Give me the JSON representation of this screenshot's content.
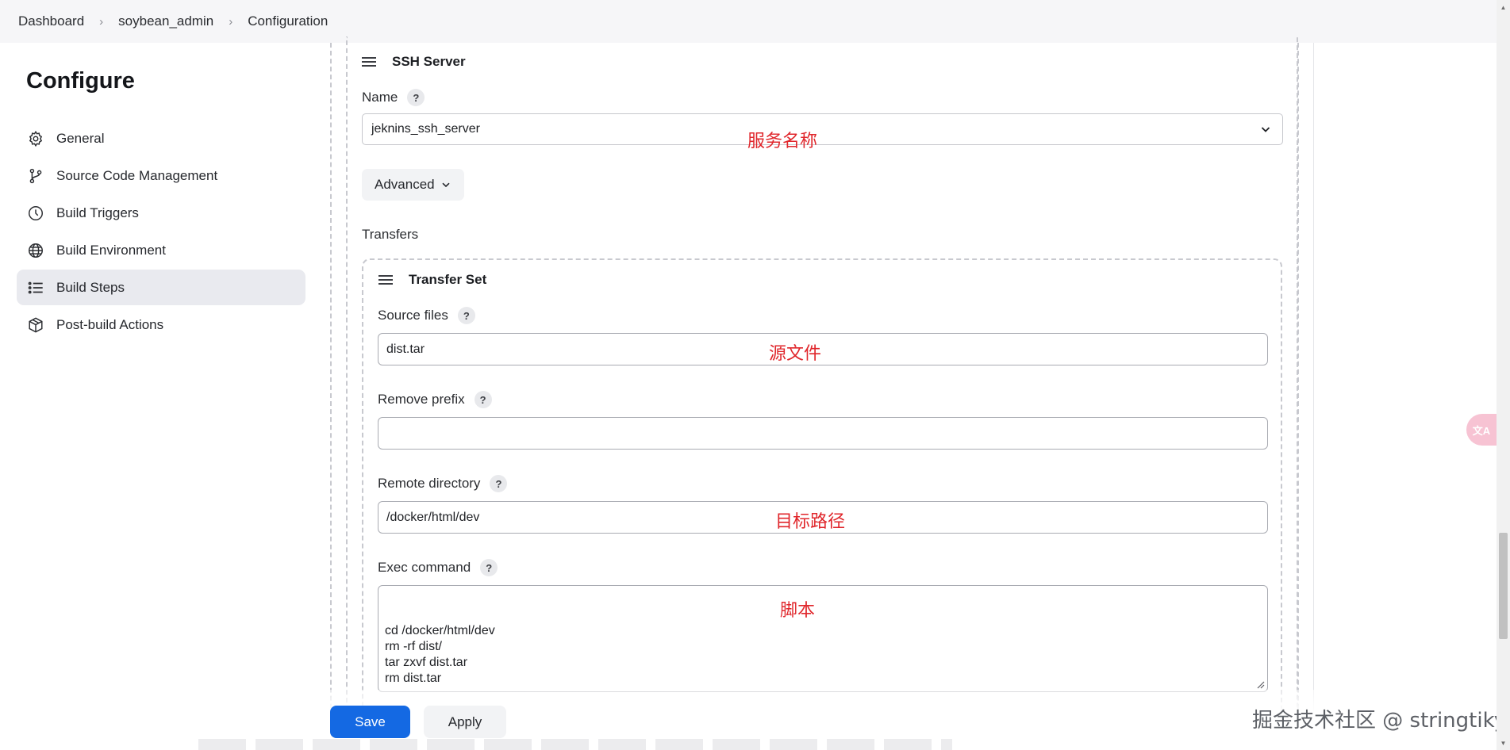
{
  "breadcrumb": {
    "items": [
      {
        "label": "Dashboard"
      },
      {
        "label": "soybean_admin"
      },
      {
        "label": "Configuration"
      }
    ],
    "separator": ">"
  },
  "sidebar": {
    "title": "Configure",
    "items": [
      {
        "label": "General",
        "icon": "gear-icon"
      },
      {
        "label": "Source Code Management",
        "icon": "branch-icon"
      },
      {
        "label": "Build Triggers",
        "icon": "clock-icon"
      },
      {
        "label": "Build Environment",
        "icon": "globe-icon"
      },
      {
        "label": "Build Steps",
        "icon": "list-icon",
        "active": true
      },
      {
        "label": "Post-build Actions",
        "icon": "package-icon"
      }
    ]
  },
  "ssh_server": {
    "title": "SSH Server",
    "name_label": "Name",
    "name_value": "jeknins_ssh_server",
    "advanced_label": "Advanced",
    "transfers_label": "Transfers"
  },
  "transfer_set": {
    "title": "Transfer Set",
    "source_files": {
      "label": "Source files",
      "value": "dist.tar"
    },
    "remove_prefix": {
      "label": "Remove prefix",
      "value": ""
    },
    "remote_directory": {
      "label": "Remote directory",
      "value": "/docker/html/dev"
    },
    "exec_command": {
      "label": "Exec command",
      "value": "cd /docker/html/dev\nrm -rf dist/\ntar zxvf dist.tar\nrm dist.tar"
    }
  },
  "help_glyph": "?",
  "annotations": {
    "name": "服务名称",
    "source": "源文件",
    "remote": "目标路径",
    "exec": "脚本"
  },
  "footer": {
    "save_label": "Save",
    "apply_label": "Apply",
    "watermark": "掘金技术社区 @ stringtiky"
  },
  "translate_fab_label": "文A",
  "colors": {
    "primary": "#1469e3",
    "annotation_red": "#e0262b",
    "active_nav_bg": "#e9eaef"
  }
}
